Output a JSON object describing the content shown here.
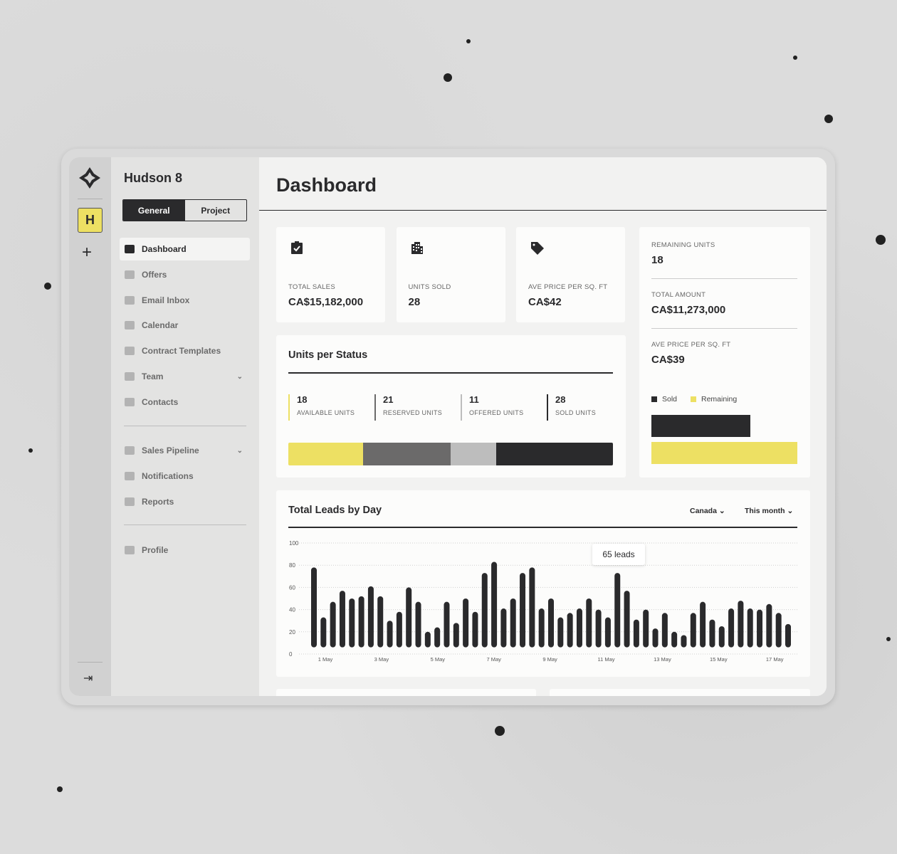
{
  "app": {
    "workspace_title": "Hudson 8",
    "workspace_badge": "H",
    "tabs": [
      {
        "label": "General",
        "active": true
      },
      {
        "label": "Project",
        "active": false
      }
    ]
  },
  "sidebar": {
    "items": [
      {
        "label": "Dashboard",
        "icon": "dashboard-icon",
        "active": true
      },
      {
        "label": "Offers",
        "icon": "tag-icon"
      },
      {
        "label": "Email Inbox",
        "icon": "mail-icon"
      },
      {
        "label": "Calendar",
        "icon": "calendar-icon"
      },
      {
        "label": "Contract Templates",
        "icon": "document-icon"
      },
      {
        "label": "Team",
        "icon": "team-icon",
        "chevron": true
      },
      {
        "label": "Contacts",
        "icon": "contacts-icon"
      }
    ],
    "items2": [
      {
        "label": "Sales Pipeline",
        "icon": "cart-icon",
        "chevron": true
      },
      {
        "label": "Notifications",
        "icon": "bell-icon"
      },
      {
        "label": "Reports",
        "icon": "reports-icon"
      }
    ],
    "items3": [
      {
        "label": "Profile",
        "icon": "person-icon"
      }
    ]
  },
  "header": {
    "title": "Dashboard"
  },
  "stats": [
    {
      "label": "TOTAL SALES",
      "value": "CA$15,182,000",
      "icon": "clipboard-check-icon"
    },
    {
      "label": "UNITS SOLD",
      "value": "28",
      "icon": "building-icon"
    },
    {
      "label": "AVE PRICE PER SQ. FT",
      "value": "CA$42",
      "icon": "tag-icon"
    }
  ],
  "remaining": {
    "items": [
      {
        "label": "REMAINING UNITS",
        "value": "18"
      },
      {
        "label": "TOTAL AMOUNT",
        "value": "CA$11,273,000"
      },
      {
        "label": "AVE PRICE PER SQ. FT",
        "value": "CA$39"
      }
    ],
    "legend": [
      {
        "label": "Sold",
        "color": "#2a2a2c"
      },
      {
        "label": "Remaining",
        "color": "#ede063"
      }
    ],
    "sold_fraction": 0.68,
    "remaining_fraction": 1.0
  },
  "units_status": {
    "title": "Units per Status",
    "items": [
      {
        "value": 18,
        "label": "AVAILABLE UNITS",
        "color": "#ede063"
      },
      {
        "value": 21,
        "label": "RESERVED UNITS",
        "color": "#6b6a6a"
      },
      {
        "value": 11,
        "label": "OFFERED UNITS",
        "color": "#bdbdbd"
      },
      {
        "value": 28,
        "label": "SOLD UNITS",
        "color": "#2a2a2c"
      }
    ]
  },
  "leads": {
    "title": "Total Leads by Day",
    "filters": [
      "Canada",
      "This month"
    ],
    "tooltip": "65 leads"
  },
  "chart_data": {
    "type": "bar",
    "ylim": [
      0,
      100
    ],
    "yticks": [
      0,
      20,
      40,
      60,
      80,
      100
    ],
    "grid": true,
    "xtick_labels": [
      "1 May",
      "3 May",
      "5 May",
      "7 May",
      "9 May",
      "11 May",
      "13 May",
      "15 May",
      "17 May"
    ],
    "values": [
      78,
      33,
      47,
      57,
      50,
      52,
      61,
      52,
      30,
      38,
      60,
      47,
      20,
      24,
      47,
      28,
      50,
      38,
      73,
      83,
      41,
      50,
      73,
      78,
      41,
      50,
      33,
      37,
      41,
      50,
      40,
      33,
      73,
      57,
      31,
      40,
      23,
      37,
      20,
      17,
      37,
      47,
      31,
      25,
      41,
      48,
      41,
      40,
      45,
      37,
      27
    ],
    "highlight_index": 32
  }
}
